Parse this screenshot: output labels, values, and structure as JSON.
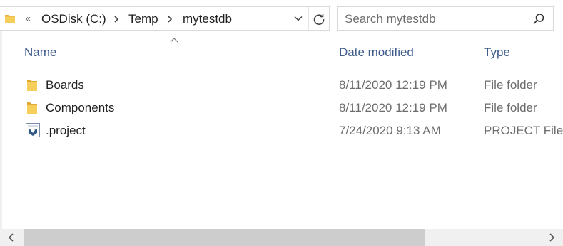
{
  "address_bar": {
    "overflow_label": "«",
    "crumbs": [
      "OSDisk (C:)",
      "Temp",
      "mytestdb"
    ]
  },
  "search": {
    "placeholder": "Search mytestdb"
  },
  "columns": {
    "name": "Name",
    "date_modified": "Date modified",
    "type": "Type",
    "sorted_by": "name",
    "sort_direction": "ascending"
  },
  "files": [
    {
      "name": "Boards",
      "date": "8/11/2020 12:19 PM",
      "type": "File folder",
      "icon": "folder-icon"
    },
    {
      "name": "Components",
      "date": "8/11/2020 12:19 PM",
      "type": "File folder",
      "icon": "folder-icon"
    },
    {
      "name": ".project",
      "date": "7/24/2020 9:13 AM",
      "type": "PROJECT File",
      "icon": "project-file-icon"
    }
  ],
  "colors": {
    "folder": "#f2c94c",
    "header_text": "#3c5a8a",
    "scroll_thumb": "#cdcdcd"
  }
}
